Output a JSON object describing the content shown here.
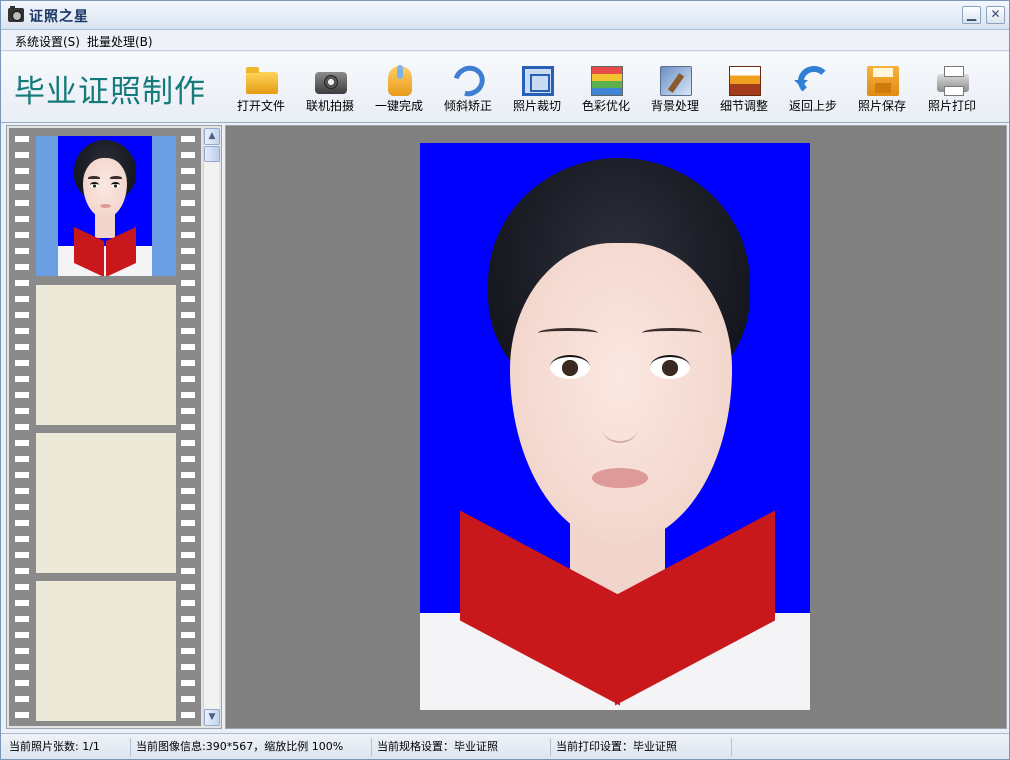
{
  "window": {
    "title": "证照之星",
    "minimize_glyph": "▁",
    "close_glyph": "✕"
  },
  "menu": {
    "items": [
      {
        "label": "系统设置(S)"
      },
      {
        "label": "批量处理(B)"
      }
    ]
  },
  "toolbar": {
    "app_title": "毕业证照制作",
    "tools": [
      {
        "label": "打开文件",
        "icon": "folder-open-icon"
      },
      {
        "label": "联机拍摄",
        "icon": "camera-icon"
      },
      {
        "label": "一键完成",
        "icon": "hand-pointer-icon"
      },
      {
        "label": "倾斜矫正",
        "icon": "tilt-correct-icon"
      },
      {
        "label": "照片裁切",
        "icon": "crop-icon"
      },
      {
        "label": "色彩优化",
        "icon": "color-optimize-icon"
      },
      {
        "label": "背景处理",
        "icon": "background-brush-icon"
      },
      {
        "label": "细节调整",
        "icon": "histogram-icon"
      },
      {
        "label": "返回上步",
        "icon": "undo-icon"
      },
      {
        "label": "照片保存",
        "icon": "save-disk-icon"
      },
      {
        "label": "照片打印",
        "icon": "printer-icon"
      }
    ]
  },
  "filmstrip": {
    "frames": 4,
    "scroll_up_glyph": "▲",
    "scroll_down_glyph": "▼"
  },
  "colors": {
    "photo_background": "#0000ff",
    "thumbnail_frame": "#6b9fe4",
    "canvas_background": "#808080",
    "app_title": "#157a7a"
  },
  "status": {
    "photo_count": "当前照片张数: 1/1",
    "image_info": "当前图像信息:390*567，缩放比例 100%",
    "spec_setting": "当前规格设置：毕业证照",
    "print_setting": "当前打印设置：毕业证照"
  }
}
